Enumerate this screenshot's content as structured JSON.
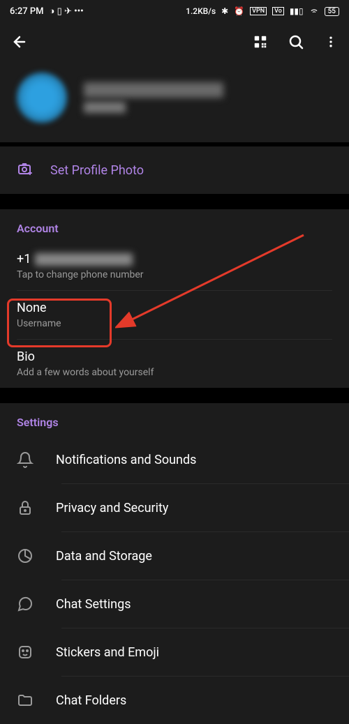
{
  "status": {
    "time": "6:27 PM",
    "netspeed": "1.2KB/s",
    "battery": "55"
  },
  "profile": {
    "set_photo_label": "Set Profile Photo"
  },
  "account": {
    "header": "Account",
    "phone_prefix": "+1",
    "phone_hint": "Tap to change phone number",
    "username_value": "None",
    "username_label": "Username",
    "bio_value": "Bio",
    "bio_hint": "Add a few words about yourself"
  },
  "settings": {
    "header": "Settings",
    "items": [
      {
        "label": "Notifications and Sounds"
      },
      {
        "label": "Privacy and Security"
      },
      {
        "label": "Data and Storage"
      },
      {
        "label": "Chat Settings"
      },
      {
        "label": "Stickers and Emoji"
      },
      {
        "label": "Chat Folders"
      }
    ]
  }
}
